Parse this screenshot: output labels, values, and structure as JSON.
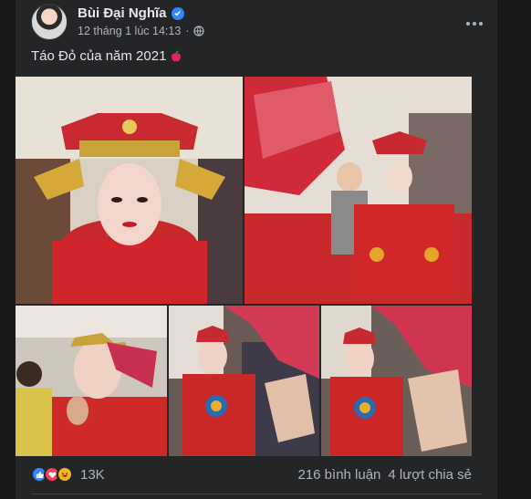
{
  "post": {
    "author": "Bùi Đại Nghĩa",
    "timestamp": "12 tháng 1 lúc 14:13",
    "caption": "Táo Đỏ của năm 2021",
    "verified_icon": "verified-badge-icon",
    "privacy_icon": "globe-icon",
    "more_icon": "more-horizontal-icon",
    "caption_emoji_icon": "red-apple-icon"
  },
  "photos": [
    {
      "name": "photo-1",
      "alt": "Performer in red costume and ornate headdress"
    },
    {
      "name": "photo-2",
      "alt": "Performer in red costume backstage"
    },
    {
      "name": "photo-3",
      "alt": "Costume being adjusted"
    },
    {
      "name": "photo-4",
      "alt": "Performer seated in red costume"
    },
    {
      "name": "photo-5",
      "alt": "Headdress being adjusted"
    }
  ],
  "engagement": {
    "reaction_icons": [
      "like-icon",
      "love-icon",
      "haha-icon"
    ],
    "reaction_count": "13K",
    "comments": "216 bình luận",
    "shares": "4 lượt chia sẻ"
  },
  "colors": {
    "background": "#18191a",
    "card": "#242526",
    "primary_text": "#e4e6eb",
    "secondary_text": "#b0b3b8",
    "accent": "#2d88ff"
  }
}
